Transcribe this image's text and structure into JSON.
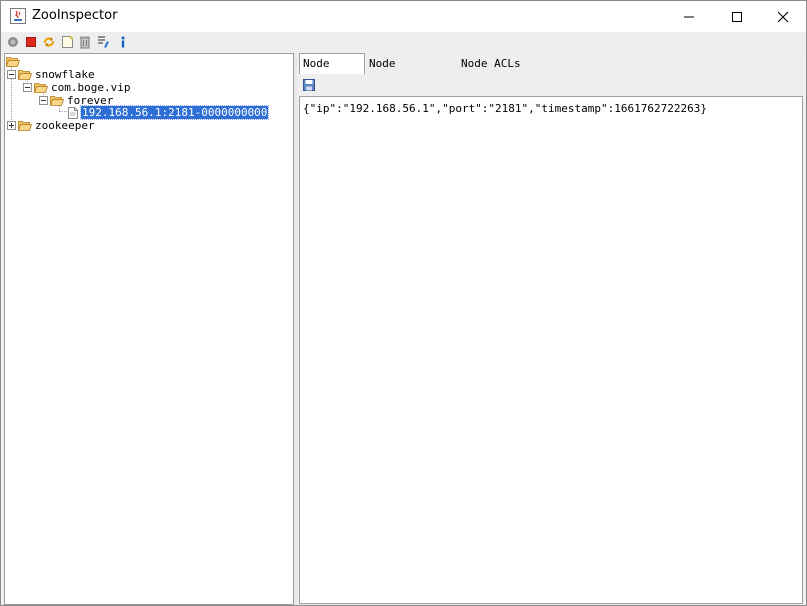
{
  "window": {
    "title": "ZooInspector"
  },
  "toolbar": {
    "icons": [
      "connect-icon",
      "disconnect-icon",
      "refresh-icon",
      "add-node-icon",
      "delete-node-icon",
      "add-watch-icon",
      "info-icon"
    ]
  },
  "tree": {
    "nodes": [
      {
        "label": "snowflake"
      },
      {
        "label": "com.boge.vip"
      },
      {
        "label": "forever"
      },
      {
        "label": "192.168.56.1:2181-0000000000"
      },
      {
        "label": "zookeeper"
      }
    ]
  },
  "tabs": [
    {
      "label": "Node Data"
    },
    {
      "label": "Node Metadata"
    },
    {
      "label": "Node ACLs"
    }
  ],
  "node_data": {
    "content": "{\"ip\":\"192.168.56.1\",\"port\":\"2181\",\"timestamp\":1661762722263}"
  },
  "colors": {
    "selection": "#2e6fd6",
    "folder": "#e8a93a",
    "info": "#1560c0"
  }
}
